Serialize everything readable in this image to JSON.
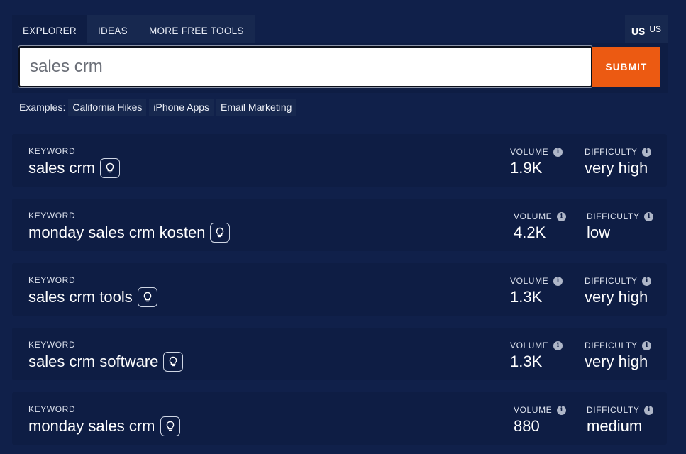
{
  "tabs": [
    {
      "label": "EXPLORER",
      "active": true
    },
    {
      "label": "IDEAS",
      "active": false
    },
    {
      "label": "MORE FREE TOOLS",
      "active": false
    }
  ],
  "country": {
    "flag": "US",
    "code": "US"
  },
  "search": {
    "value": "sales crm",
    "submit_label": "SUBMIT"
  },
  "examples": {
    "label": "Examples:",
    "items": [
      "California Hikes",
      "iPhone Apps",
      "Email Marketing"
    ]
  },
  "labels": {
    "keyword": "KEYWORD",
    "volume": "VOLUME",
    "difficulty": "DIFFICULTY"
  },
  "results": [
    {
      "keyword": "sales crm",
      "volume": "1.9K",
      "difficulty": "very high"
    },
    {
      "keyword": "monday sales crm kosten",
      "volume": "4.2K",
      "difficulty": "low"
    },
    {
      "keyword": "sales crm tools",
      "volume": "1.3K",
      "difficulty": "very high"
    },
    {
      "keyword": "sales crm software",
      "volume": "1.3K",
      "difficulty": "very high"
    },
    {
      "keyword": "monday sales crm",
      "volume": "880",
      "difficulty": "medium"
    }
  ],
  "colors": {
    "accent": "#ec5a12",
    "background": "#10204a",
    "panel": "#0e1d44"
  }
}
